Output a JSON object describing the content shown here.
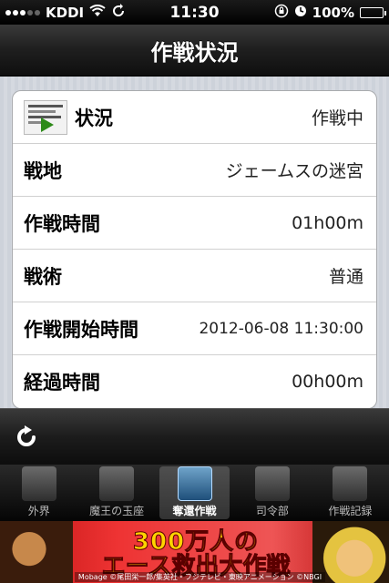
{
  "status_bar": {
    "carrier": "KDDI",
    "time": "11:30",
    "battery": "100%",
    "battery_level": 1.0
  },
  "nav": {
    "title": "作戦状況"
  },
  "rows": [
    {
      "label": "状況",
      "value": "作戦中"
    },
    {
      "label": "戦地",
      "value": "ジェームスの迷宮"
    },
    {
      "label": "作戦時間",
      "value": "01h00m"
    },
    {
      "label": "戦術",
      "value": "普通"
    },
    {
      "label": "作戦開始時間",
      "value": "2012-06-08 11:30:00"
    },
    {
      "label": "経過時間",
      "value": "00h00m"
    }
  ],
  "toolbar": {
    "refresh_icon": "refresh-icon"
  },
  "tabs": [
    {
      "label": "外界",
      "selected": false
    },
    {
      "label": "魔王の玉座",
      "selected": false
    },
    {
      "label": "奪還作戦",
      "selected": true
    },
    {
      "label": "司令部",
      "selected": false
    },
    {
      "label": "作戦記録",
      "selected": false
    }
  ],
  "ad": {
    "line1": "300万人の",
    "line2": "エース救出大作戦",
    "credit": "Mobage ©尾田栄一郎/集英社・フジテレビ・東映アニメーション ©NBGI"
  },
  "colors": {
    "accent_green": "#2e8a1a",
    "ad_red": "#e33333",
    "ad_yellow": "#ffd400"
  }
}
